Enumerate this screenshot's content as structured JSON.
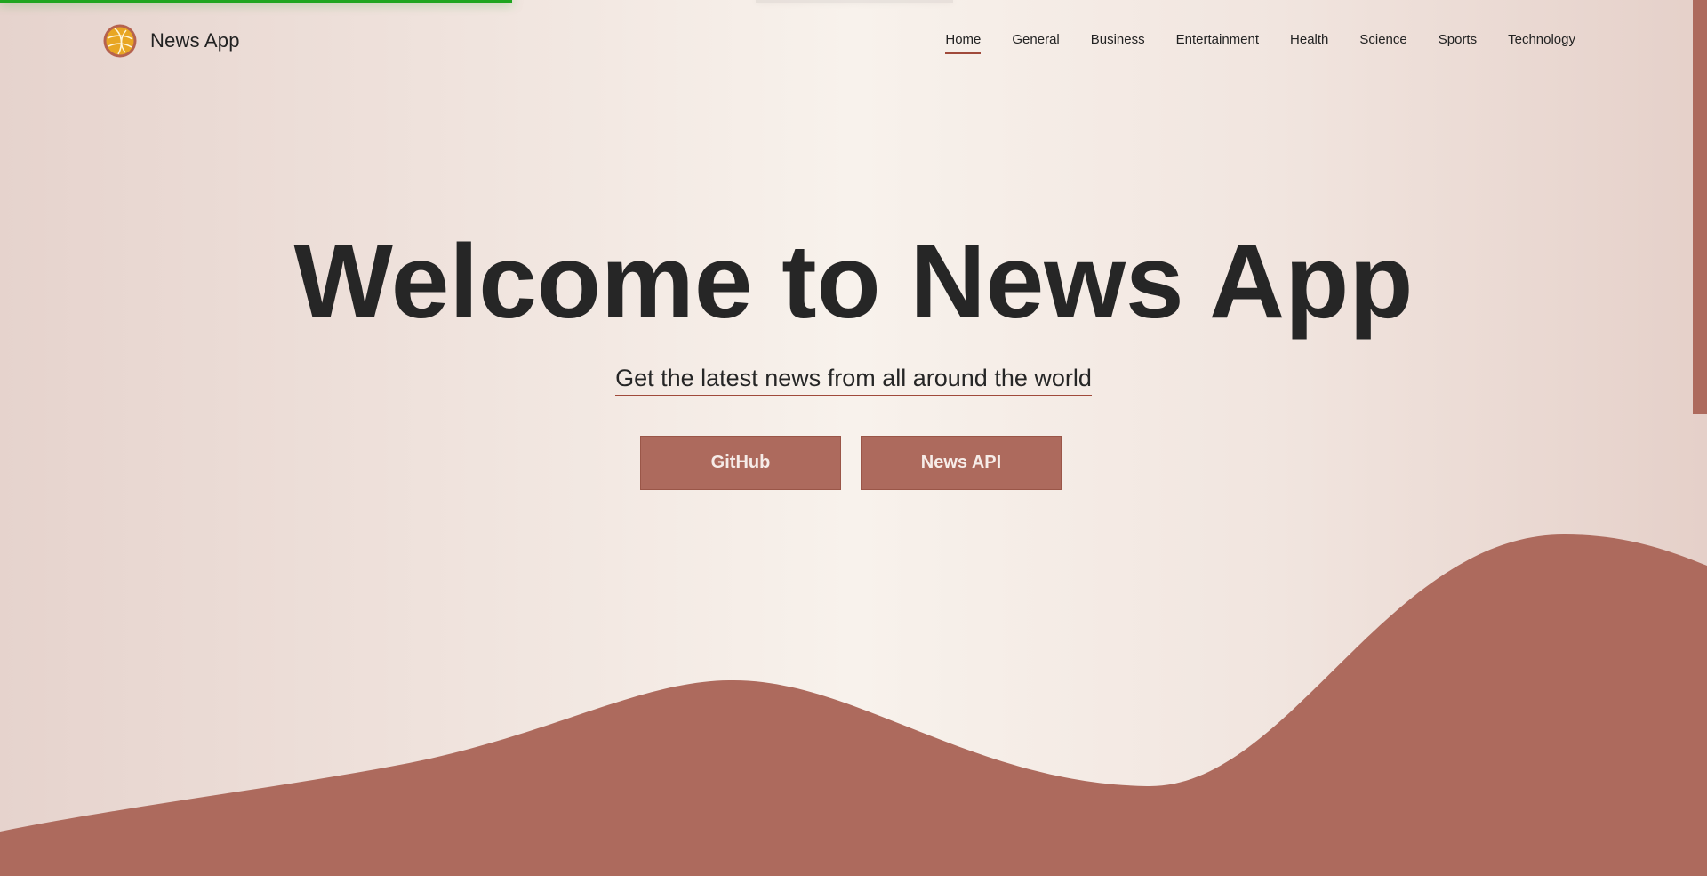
{
  "brand": {
    "name": "News App",
    "logo_icon": "globe-icon"
  },
  "nav": {
    "items": [
      {
        "label": "Home",
        "active": true
      },
      {
        "label": "General"
      },
      {
        "label": "Business"
      },
      {
        "label": "Entertainment"
      },
      {
        "label": "Health"
      },
      {
        "label": "Science"
      },
      {
        "label": "Sports"
      },
      {
        "label": "Technology"
      }
    ]
  },
  "hero": {
    "title": "Welcome to News App",
    "subtitle": "Get the latest news from all around the world",
    "buttons": [
      {
        "label": "GitHub"
      },
      {
        "label": "News API"
      }
    ]
  },
  "colors": {
    "accent": "#ad6a5d",
    "progress": "#1fa51f",
    "text": "#262626",
    "underline": "#a04a3b"
  }
}
